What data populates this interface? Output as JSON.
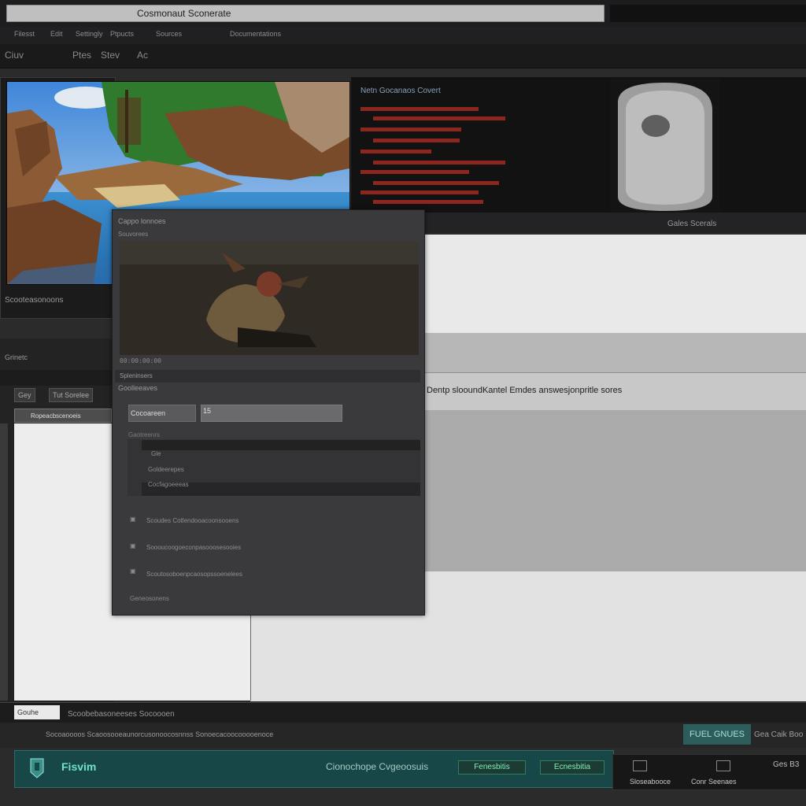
{
  "window": {
    "title": "Cosmonaut Sconerate"
  },
  "menubar": {
    "items": [
      "Filesst",
      "Edit",
      "Settingly",
      "Ptpucts",
      "Sources",
      "Documentations"
    ]
  },
  "toolbar": {
    "items": [
      "Ciuv",
      "Ptes",
      "Stev",
      "Ac"
    ]
  },
  "viewer": {
    "status": "Scooteasonoons"
  },
  "logpanel": {
    "heading": "Netn Gocanaos Covert",
    "caption": "Gales Scerals",
    "accent_color": "#a32a22"
  },
  "right": {
    "bar_text": "Dentp slooundKantel Emdes answesjonpritle sores"
  },
  "left_lower": {
    "title": "Grinetc",
    "tab1": "Gey",
    "tab2": "Tut Sorelee",
    "path": "Ropeacbscenoeis"
  },
  "dialog": {
    "title": "Cappo lonnoes",
    "subtitle": "Souvorees",
    "timecode": "00:00:00:00",
    "section": "Spleninsers",
    "row1": "Goolleeaves",
    "field_label": "Cocoareen",
    "field_value": "15",
    "list_label": "Gaotreenrs",
    "list_items": [
      "Gle",
      "Goldeerepes",
      "Cocfagoeeeas"
    ],
    "entries": [
      "Scoudes Cotlendooacoonsooens",
      "Soooucoogoeconpasooosesooies",
      "Scoutosoboenpcaosopssoenelees"
    ],
    "footer": "Geneosonens"
  },
  "status1": {
    "tab": "Gouhe",
    "text": "Scoobebasoneeses Socoooen"
  },
  "status2": {
    "text": "Socoaoooos Scaoosooeaunorcusonoocosnnss Sonoecacoocooooenoce",
    "badge": "FUEL GNUES",
    "right": "Gea Caik Boo"
  },
  "taskbar": {
    "brand": "Fisvim",
    "center": "Cionochope Cvgeoosuis",
    "chip1": "Fenesbitis",
    "chip2": "Ecnesbitia",
    "tray1": "Sloseabooce",
    "tray2": "Conr Seenaes",
    "tray_right": "Ges B3",
    "accent_color": "#174847"
  }
}
